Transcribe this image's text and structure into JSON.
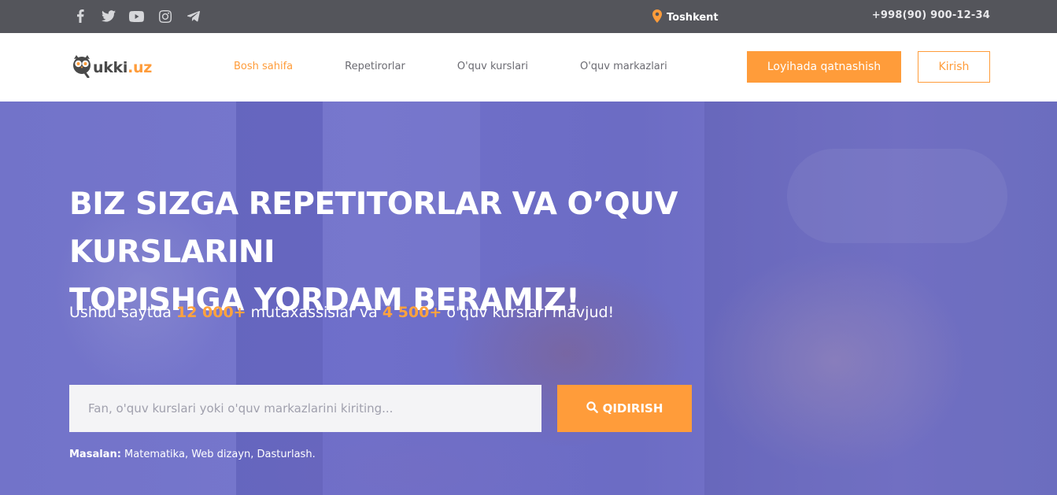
{
  "topbar": {
    "social": [
      {
        "icon": "facebook-icon"
      },
      {
        "icon": "twitter-icon"
      },
      {
        "icon": "youtube-icon"
      },
      {
        "icon": "instagram-icon"
      },
      {
        "icon": "telegram-icon"
      }
    ],
    "city": "Toshkent",
    "phone": "+998(90) 900-12-34"
  },
  "nav": {
    "logo_main": "ukki",
    "logo_suffix": ".uz",
    "links": [
      {
        "label": "Bosh sahifa",
        "active": true
      },
      {
        "label": "Repetirorlar",
        "active": false
      },
      {
        "label": "O'quv kurslari",
        "active": false
      },
      {
        "label": "O'quv markazlari",
        "active": false
      }
    ],
    "primary_button": "Loyihada qatnashish",
    "login_button": "Kirish"
  },
  "hero": {
    "title_line1": "BIZ SIZGA REPETITORLAR VA O’QUV KURSLARINI",
    "title_line2": "TOPISHGA YORDAM BERAMIZ!",
    "sub_pre": "Ushbu saytda ",
    "sub_count1": "12 000+",
    "sub_mid": " mutaxassislar va ",
    "sub_count2": "4 500+",
    "sub_post": " o'quv kurslari mavjud!",
    "search_placeholder": "Fan, o'quv kurslari yoki o'quv markazlarini kiriting...",
    "search_button": "QIDIRISH",
    "examples_label": "Masalan:",
    "examples": [
      "Matematika",
      "Web dizayn",
      "Dasturlash"
    ]
  },
  "colors": {
    "accent": "#ff9c3a",
    "topbar_bg": "#54555b",
    "hero_overlay": "#6b6cc6"
  }
}
